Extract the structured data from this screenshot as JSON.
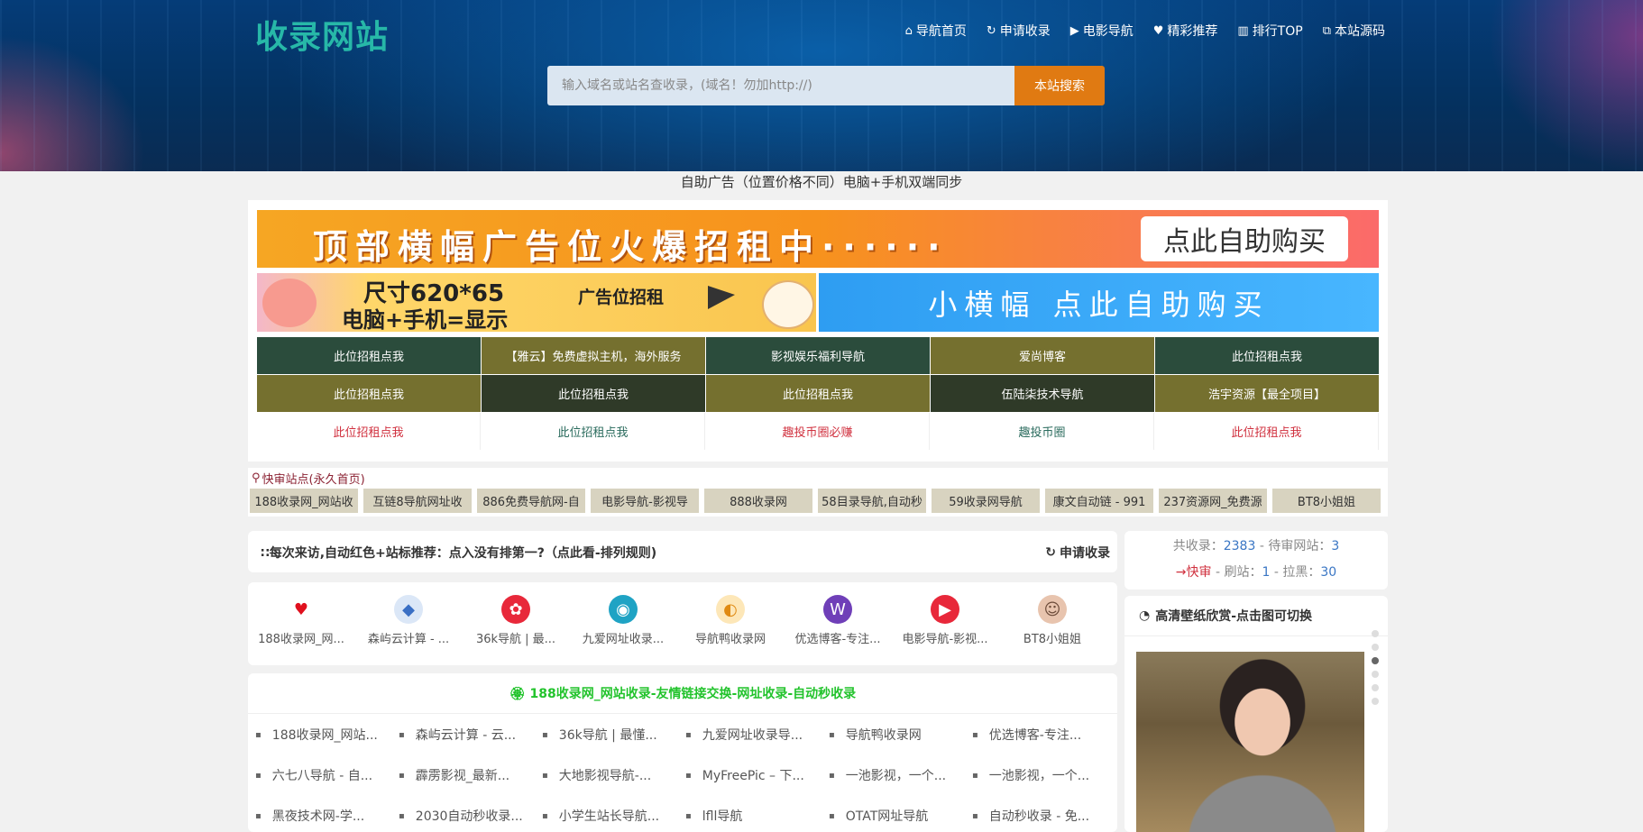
{
  "header": {
    "logo": "收录网站",
    "nav": [
      {
        "icon": "⌂",
        "icon_name": "home-icon",
        "label": "导航首页"
      },
      {
        "icon": "↻",
        "icon_name": "refresh-icon",
        "label": "申请收录"
      },
      {
        "icon": "▶",
        "icon_name": "video-icon",
        "label": "电影导航"
      },
      {
        "icon": "♥",
        "icon_name": "heart-icon",
        "label": "精彩推荐"
      },
      {
        "icon": "▥",
        "icon_name": "bar-chart-icon",
        "label": "排行TOP"
      },
      {
        "icon": "⧉",
        "icon_name": "external-link-icon",
        "label": "本站源码"
      }
    ],
    "search": {
      "placeholder": "输入域名或站名查收录，(域名！勿加http://)",
      "button": "本站搜索"
    }
  },
  "ad": {
    "notice": "自助广告（位置价格不同）电脑+手机双端同步",
    "banner_top": {
      "text": "顶部横幅广告位火爆招租中······",
      "button": "点此自助购买"
    },
    "banner_left": {
      "line1": "尺寸620*65",
      "line2": "电脑+手机=显示",
      "tag": "广告位招租"
    },
    "banner_right": "小横幅 点此自助购买",
    "grid": [
      {
        "label": "此位招租点我",
        "style": "c-green"
      },
      {
        "label": "【雅云】免费虚拟主机，海外服务",
        "style": "c-olive"
      },
      {
        "label": "影视娱乐福利导航",
        "style": "c-green"
      },
      {
        "label": "爱尚博客",
        "style": "c-olive"
      },
      {
        "label": "此位招租点我",
        "style": "c-green"
      },
      {
        "label": "此位招租点我",
        "style": "c-olive"
      },
      {
        "label": "此位招租点我",
        "style": "c-dark"
      },
      {
        "label": "此位招租点我",
        "style": "c-olive"
      },
      {
        "label": "伍陆柒技术导航",
        "style": "c-dark"
      },
      {
        "label": "浩宇资源【最全项目】",
        "style": "c-olive"
      },
      {
        "label": "此位招租点我",
        "style": "c-white t-red"
      },
      {
        "label": "此位招租点我",
        "style": "c-white t-teal"
      },
      {
        "label": "趣投币圈必赚",
        "style": "c-white t-red"
      },
      {
        "label": "趣投币圈",
        "style": "c-white t-teal"
      },
      {
        "label": "此位招租点我",
        "style": "c-white t-red"
      }
    ]
  },
  "quick": {
    "title": "快审站点(永久首页)",
    "items": [
      "188收录网_网站收",
      "互链8导航网址收",
      "886免费导航网-自",
      "电影导航-影视导",
      "888收录网",
      "58目录导航,自动秒",
      "59收录网导航",
      "康文自动链 - 991",
      "237资源网_免费源",
      "BT8小姐姐"
    ]
  },
  "recommend": {
    "text": "∷每次来访,自动红色+站标推荐：点入没有排第一?（点此看-排列规则)",
    "apply": "申请收录"
  },
  "icon_sites": [
    {
      "name": "188收录网_网...",
      "icon": "♥",
      "color": "#ffffff",
      "fg": "#e0101e"
    },
    {
      "name": "森屿云计算 - ...",
      "icon": "◆",
      "color": "#dbe7f7",
      "fg": "#3a6fc4"
    },
    {
      "name": "36k导航 | 最...",
      "icon": "✿",
      "color": "#e8283a",
      "fg": "#ffffff"
    },
    {
      "name": "九爱网址收录...",
      "icon": "◉",
      "color": "#1fa3c4",
      "fg": "#ffffff"
    },
    {
      "name": "导航鸭收录网",
      "icon": "◐",
      "color": "#fde7b8",
      "fg": "#e08a12"
    },
    {
      "name": "优选博客-专注...",
      "icon": "W",
      "color": "#6f3fb8",
      "fg": "#ffffff"
    },
    {
      "name": "电影导航-影视...",
      "icon": "▶",
      "color": "#e8283a",
      "fg": "#ffffff"
    },
    {
      "name": "BT8小姐姐",
      "icon": "☺",
      "color": "#e8c4ae",
      "fg": "#6b4a38"
    }
  ],
  "links": {
    "title": "🏵 188收录网_网站收录-友情链接交换-网址收录-自动秒收录",
    "items": [
      "188收录网_网站...",
      "森屿云计算 - 云...",
      "36k导航 | 最懂...",
      "九爱网址收录导...",
      "导航鸭收录网",
      "优选博客-专注...",
      "六七八导航 - 自...",
      "霹雳影视_最新...",
      "大地影视导航-...",
      "MyFreePic – 下...",
      "一池影视，一个...",
      "一池影视，一个...",
      "黑夜技术网-学...",
      "2030自动秒收录...",
      "小学生站长导航...",
      "lfll导航",
      "OTAT网址导航",
      "自动秒收录 - 免..."
    ]
  },
  "stats": {
    "total_label": "共收录：",
    "total": "2383",
    "pending_label": " - 待审网站：",
    "pending": "3",
    "fast_label": "→快审",
    "refresh_label": " - 刷站：",
    "refresh": "1",
    "black_label": " - 拉黑：",
    "black": "30"
  },
  "wallpaper": {
    "title": "高清壁纸欣赏-点击图可切换",
    "active_dot": 2
  }
}
